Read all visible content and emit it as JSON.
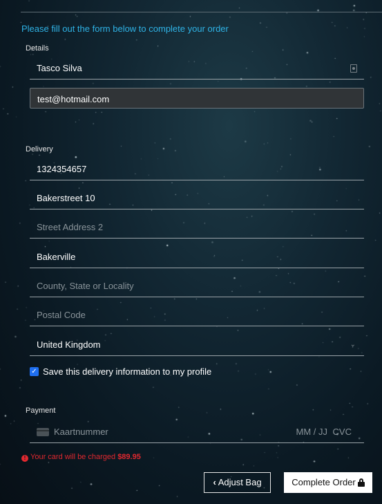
{
  "intro_text": "Please fill out the form below to complete your order",
  "details": {
    "label": "Details",
    "full_name": "Tasco Silva",
    "email": "test@hotmail.com"
  },
  "delivery": {
    "label": "Delivery",
    "phone": "1324354657",
    "street1": "Bakerstreet 10",
    "street2_placeholder": "Street Address 2",
    "town": "Bakerville",
    "county_placeholder": "County, State or Locality",
    "postcode_placeholder": "Postal Code",
    "country": "United Kingdom",
    "save_label": "Save this delivery information to my profile",
    "save_checked": true
  },
  "payment": {
    "label": "Payment",
    "card_number_placeholder": "Kaartnummer",
    "expiry_placeholder": "MM / JJ",
    "cvc_placeholder": "CVC"
  },
  "charge": {
    "prefix": "Your card will be charged",
    "amount": "$89.95"
  },
  "buttons": {
    "adjust": "Adjust Bag",
    "adjust_icon": "chevron-left-icon",
    "complete": "Complete Order",
    "complete_icon": "lock-icon"
  },
  "colors": {
    "accent": "#2fb3e6",
    "error": "#e0282f",
    "checkbox": "#1f6ff0"
  }
}
